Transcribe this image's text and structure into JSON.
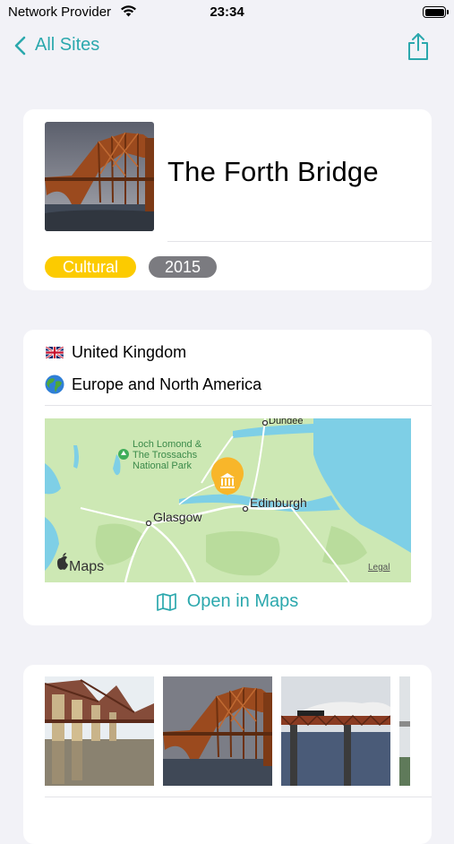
{
  "status_bar": {
    "carrier": "Network Provider",
    "time": "23:34"
  },
  "nav": {
    "back_label": "All Sites",
    "back_icon": "chevron-left-icon",
    "share_icon": "share-icon"
  },
  "site": {
    "name": "The Forth Bridge",
    "category": "Cultural",
    "year": "2015",
    "country": "United Kingdom",
    "region": "Europe and North America"
  },
  "map": {
    "labels": {
      "dundee": "Dundee",
      "loch_lomond": "Loch Lomond &",
      "trossachs": "The Trossachs",
      "national_park": "National Park",
      "glasgow": "Glasgow",
      "edinburgh": "Edinburgh",
      "legal": "Legal",
      "maps_brand": "Maps"
    },
    "open_label": "Open in Maps"
  },
  "colors": {
    "accent": "#2ba8ad",
    "cultural": "#fccb00",
    "year_badge": "#7b7b80",
    "background": "#f2f2f7"
  }
}
